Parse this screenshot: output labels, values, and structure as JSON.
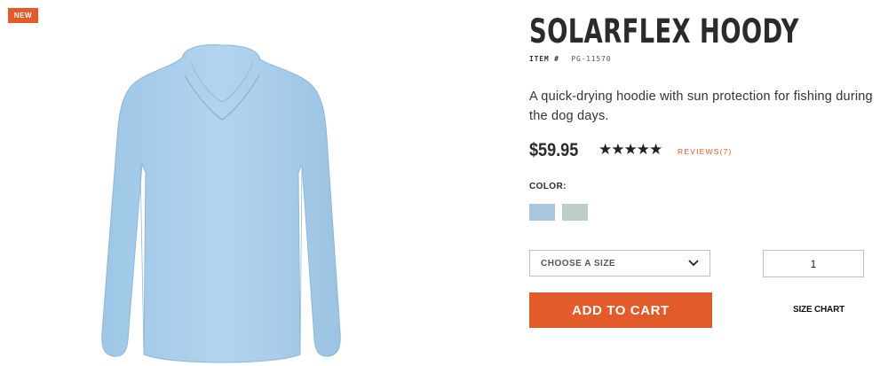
{
  "badge": {
    "label": "NEW"
  },
  "product": {
    "title": "SOLARFLEX HOODY",
    "item_label": "ITEM #",
    "item_number": "PG-11570",
    "description": "A quick-drying hoodie with sun protection for fishing during the dog days.",
    "price": "$59.95",
    "rating": {
      "stars_text": "★★★★★",
      "value": 5,
      "max": 5
    },
    "reviews_label": "REVIEWS(7)"
  },
  "color_selector": {
    "label": "COLOR:",
    "swatches": [
      {
        "name": "light-blue-swatch",
        "color": "#a9c6e0"
      },
      {
        "name": "sage-swatch",
        "color": "#bccdc6"
      }
    ]
  },
  "size_select": {
    "placeholder": "CHOOSE A SIZE"
  },
  "quantity": {
    "value": "1"
  },
  "actions": {
    "add_to_cart": "ADD TO CART",
    "size_chart": "SIZE CHART"
  },
  "colors": {
    "accent": "#e35a2b",
    "garment": "#a9ccea"
  },
  "image": {
    "icon": "hoodie-product-photo"
  }
}
